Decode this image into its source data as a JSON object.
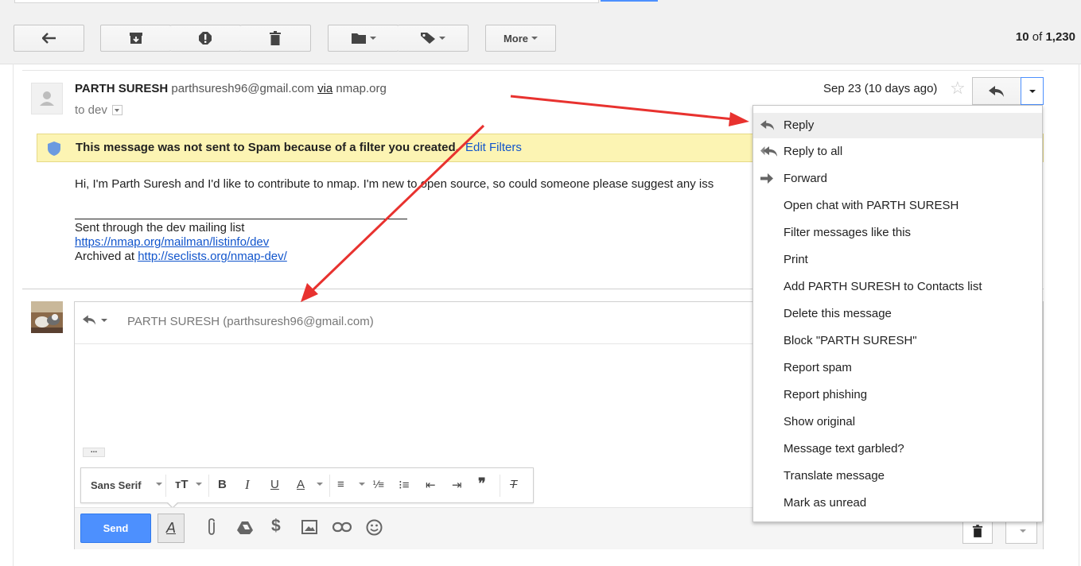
{
  "toolbar": {
    "back_icon": "back-arrow-icon",
    "archive_icon": "archive-icon",
    "spam_icon": "report-spam-icon",
    "delete_icon": "trash-icon",
    "move_icon": "folder-icon",
    "labels_icon": "label-icon",
    "more_label": "More",
    "page_range": "10",
    "page_of": "of",
    "page_total": "1,230"
  },
  "message": {
    "sender_name": "PARTH SURESH",
    "sender_email": "parthsuresh96@gmail.com",
    "via_label": "via",
    "via_domain": "nmap.org",
    "to_label": "to dev",
    "date": "Sep 23 (10 days ago)",
    "banner_text": "This message was not sent to Spam because of a filter you created.",
    "banner_link": "Edit Filters",
    "body": "Hi, I'm Parth Suresh and I'd like to contribute to nmap. I'm new to open source, so could someone please suggest any iss",
    "sig_line1": "Sent through the dev mailing list",
    "sig_link1": "https://nmap.org/mailman/listinfo/dev",
    "sig_line3_prefix": "Archived at",
    "sig_link2": "http://seclists.org/nmap-dev/"
  },
  "compose": {
    "recipient": "PARTH SURESH (parthsuresh96@gmail.com)",
    "dots": "...",
    "font_name": "Sans Serif",
    "send_label": "Send",
    "format_label": "A"
  },
  "menu": {
    "items": [
      {
        "label": "Reply",
        "icon": "reply-icon"
      },
      {
        "label": "Reply to all",
        "icon": "reply-all-icon"
      },
      {
        "label": "Forward",
        "icon": "forward-icon"
      },
      {
        "label": "Open chat with PARTH SURESH"
      },
      {
        "label": "Filter messages like this"
      },
      {
        "label": "Print"
      },
      {
        "label": "Add PARTH SURESH to Contacts list"
      },
      {
        "label": "Delete this message"
      },
      {
        "label": "Block \"PARTH SURESH\""
      },
      {
        "label": "Report spam"
      },
      {
        "label": "Report phishing"
      },
      {
        "label": "Show original"
      },
      {
        "label": "Message text garbled?"
      },
      {
        "label": "Translate message"
      },
      {
        "label": "Mark as unread"
      }
    ]
  },
  "colors": {
    "accent_blue": "#4d90fe",
    "link_blue": "#1155cc",
    "banner_yellow": "#fcf4b3",
    "annotation_red": "#e8322f"
  }
}
